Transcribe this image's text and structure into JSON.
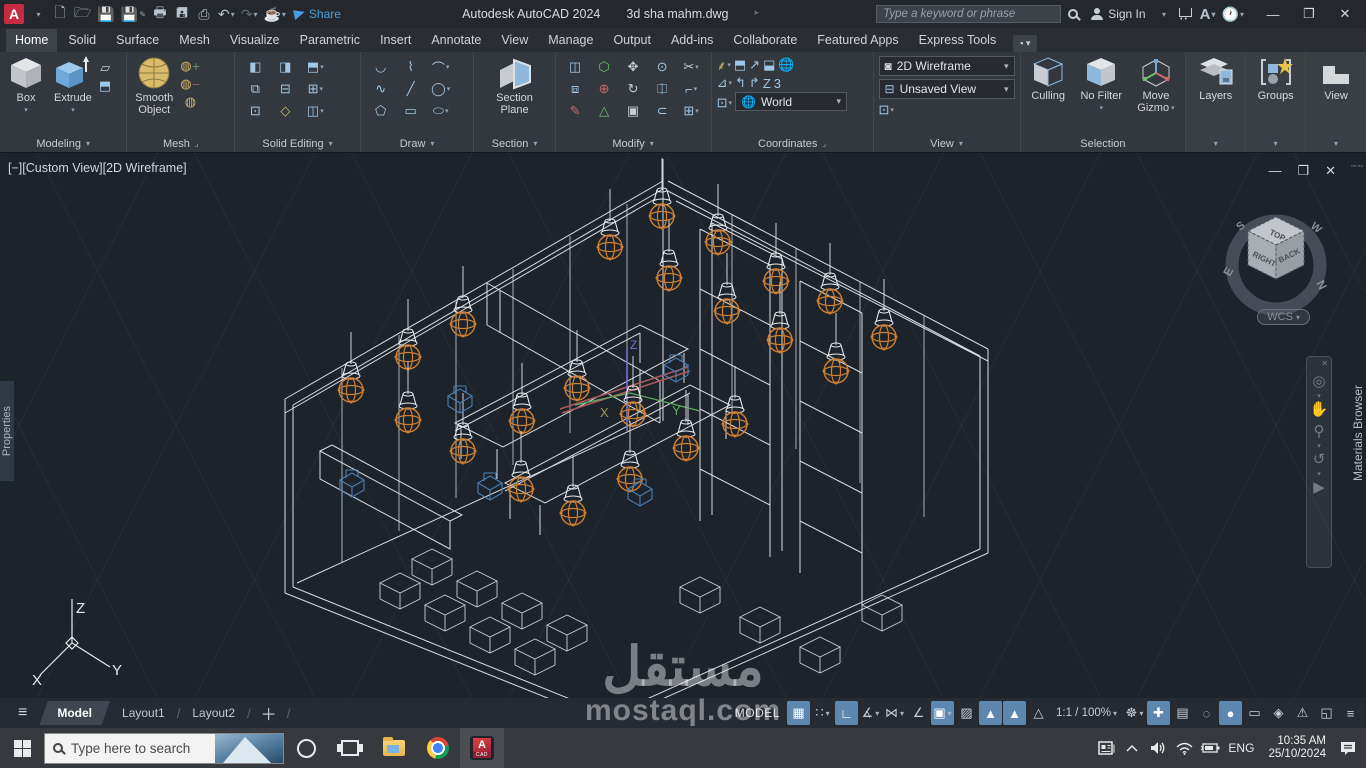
{
  "titlebar": {
    "app_title": "Autodesk AutoCAD 2024",
    "doc_name": "3d sha mahm.dwg",
    "share_label": "Share",
    "search_placeholder": "Type a keyword or phrase",
    "signin_label": "Sign In"
  },
  "ribbon": {
    "tabs": [
      "Home",
      "Solid",
      "Surface",
      "Mesh",
      "Visualize",
      "Parametric",
      "Insert",
      "Annotate",
      "View",
      "Manage",
      "Output",
      "Add-ins",
      "Collaborate",
      "Featured Apps",
      "Express Tools"
    ],
    "modeling": {
      "label": "Modeling",
      "box": "Box",
      "extrude": "Extrude"
    },
    "mesh": {
      "label": "Mesh",
      "smooth_line1": "Smooth",
      "smooth_line2": "Object"
    },
    "solid_editing": {
      "label": "Solid Editing"
    },
    "draw": {
      "label": "Draw"
    },
    "section": {
      "label": "Section",
      "plane_line1": "Section",
      "plane_line2": "Plane"
    },
    "modify": {
      "label": "Modify"
    },
    "coordinates": {
      "label": "Coordinates",
      "ucs": "World"
    },
    "view_panel": {
      "label": "View",
      "visual_style": "2D Wireframe",
      "named_view": "Unsaved View"
    },
    "selection": {
      "label": "Selection",
      "culling": "Culling",
      "no_filter": "No Filter",
      "gizmo_line1": "Move",
      "gizmo_line2": "Gizmo"
    },
    "layers": {
      "label": "Layers"
    },
    "groups": {
      "label": "Groups"
    },
    "view_tools": {
      "label": "View"
    }
  },
  "viewport": {
    "label": "[−][Custom View][2D Wireframe]",
    "properties_tab": "Properties",
    "materials_tab": "Materials Browser",
    "viewcube": {
      "top": "TOP",
      "right": "RIGHT",
      "back": "BACK",
      "n": "N",
      "e": "E",
      "s": "S",
      "w": "W",
      "wcs": "WCS"
    },
    "axes": {
      "x": "X",
      "y": "Y",
      "z": "Z"
    },
    "lamps": [
      [
        610,
        94
      ],
      [
        662,
        63
      ],
      [
        669,
        125
      ],
      [
        718,
        89
      ],
      [
        727,
        158
      ],
      [
        776,
        128
      ],
      [
        780,
        187
      ],
      [
        830,
        148
      ],
      [
        836,
        218
      ],
      [
        884,
        184
      ],
      [
        463,
        171
      ],
      [
        408,
        204
      ],
      [
        351,
        237
      ],
      [
        408,
        267
      ],
      [
        463,
        298
      ],
      [
        522,
        268
      ],
      [
        577,
        235
      ],
      [
        633,
        261
      ],
      [
        686,
        295
      ],
      [
        630,
        326
      ],
      [
        573,
        360
      ],
      [
        521,
        336
      ],
      [
        735,
        271
      ]
    ],
    "tables": [
      [
        400,
        430
      ],
      [
        445,
        452
      ],
      [
        490,
        474
      ],
      [
        535,
        496
      ],
      [
        432,
        406
      ],
      [
        477,
        428
      ],
      [
        522,
        450
      ],
      [
        567,
        472
      ],
      [
        700,
        434
      ],
      [
        760,
        464
      ],
      [
        820,
        494
      ],
      [
        882,
        452
      ]
    ],
    "blue_objects": [
      [
        460,
        243
      ],
      [
        490,
        330
      ],
      [
        352,
        327
      ],
      [
        640,
        336
      ],
      [
        676,
        212
      ]
    ]
  },
  "statusbar": {
    "layout_tabs": [
      "Model",
      "Layout1",
      "Layout2"
    ],
    "model_label": "MODEL",
    "scale": "1:1 / 100%"
  },
  "icons": {
    "grid": "▦",
    "snap": "∷",
    "ortho": "∟",
    "polar": "∡",
    "isodraft": "⋈",
    "otrack": "∠",
    "osnap": "▣",
    "transparency": "▨",
    "ann_visibility": "▲",
    "ann_autoscale": "▲",
    "ann_flash": "△",
    "workspace": "☸",
    "plus": "✚",
    "quickprops": "▤",
    "isolate": "◌",
    "hardware": "●",
    "units": "▭",
    "status3d": "◈",
    "graphics": "⚠",
    "fullscreen": "◱",
    "customize": "≡"
  },
  "taskbar": {
    "search_placeholder": "Type here to search",
    "lang": "ENG",
    "time": "10:35 AM",
    "date": "25/10/2024"
  },
  "watermark": {
    "line1": "مستقل",
    "line2": "mostaql.com"
  }
}
